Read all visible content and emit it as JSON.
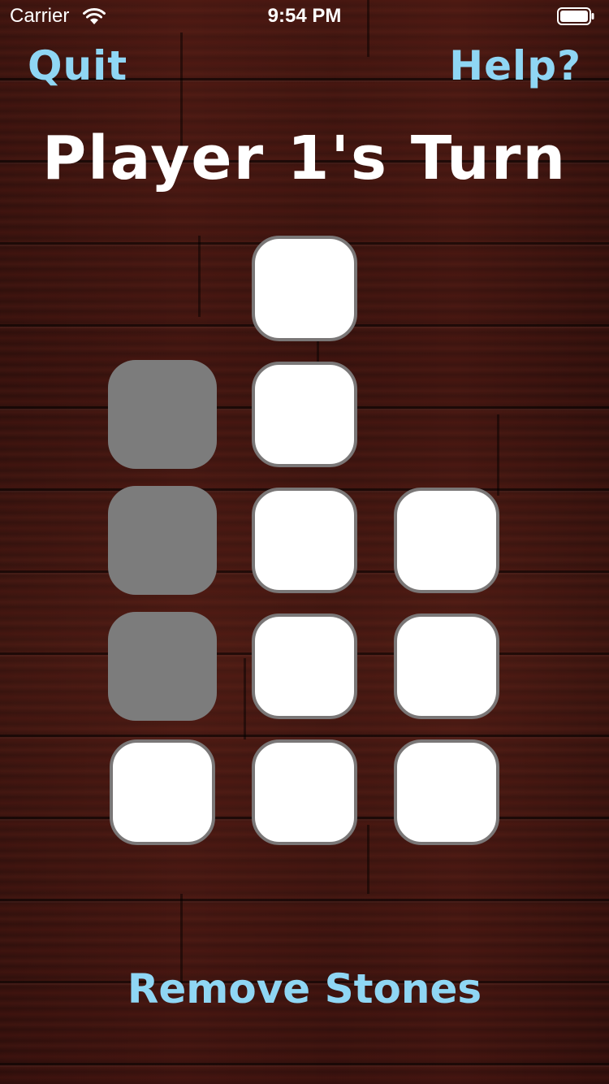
{
  "status_bar": {
    "carrier": "Carrier",
    "time": "9:54 PM",
    "wifi_icon": "wifi-icon",
    "battery_icon": "battery-icon"
  },
  "nav": {
    "quit_label": "Quit",
    "help_label": "Help?"
  },
  "turn_title": "Player 1's Turn",
  "board": {
    "columns": [
      {
        "column": 1,
        "stones": [
          "removed",
          "removed",
          "removed",
          "active"
        ]
      },
      {
        "column": 2,
        "stones": [
          "active",
          "active",
          "active",
          "active",
          "active"
        ]
      },
      {
        "column": 3,
        "stones": [
          "active",
          "active",
          "active"
        ]
      }
    ]
  },
  "action": {
    "remove_label": "Remove Stones"
  },
  "colors": {
    "accent": "#8fd6f4",
    "title": "#ffffff",
    "stone_active": "#ffffff",
    "stone_removed": "#7c7c7c",
    "stone_border": "#7a7777",
    "background": "#3a1410"
  }
}
